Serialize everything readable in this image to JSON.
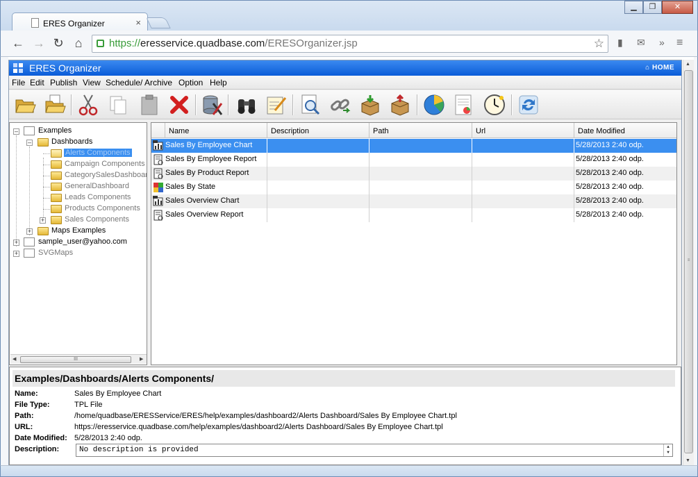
{
  "browser": {
    "tab_title": "ERES Organizer",
    "tab_close": "×",
    "url_scheme": "https://",
    "url_host": "eresservice.quadbase.com",
    "url_path": "/ERESOrganizer.jsp",
    "window_buttons": [
      "▁",
      "❐",
      "✕"
    ]
  },
  "app": {
    "title": "ERES Organizer",
    "home_label": "HOME"
  },
  "menu": [
    "File",
    "Edit",
    "Publish",
    "View",
    "Schedule/ Archive",
    "Option",
    "Help"
  ],
  "toolbar": [
    "open-folder-icon",
    "new-folder-icon",
    "cut-icon",
    "copy-icon",
    "paste-icon",
    "delete-icon",
    "database-tools-icon",
    "find-icon",
    "edit-notes-icon",
    "preview-icon",
    "link-icon",
    "import-package-icon",
    "export-package-icon",
    "pie-chart-icon",
    "report-icon",
    "scheduler-clock-icon",
    "refresh-icon"
  ],
  "tree": {
    "nodes": [
      {
        "label": "Examples",
        "level": 0,
        "type": "doc",
        "expanded": true
      },
      {
        "label": "Dashboards",
        "level": 1,
        "type": "folder",
        "expanded": true
      },
      {
        "label": "Alerts Components",
        "level": 2,
        "type": "folder",
        "selected": true
      },
      {
        "label": "Campaign Components",
        "level": 2,
        "type": "folder"
      },
      {
        "label": "CategorySalesDashboard",
        "level": 2,
        "type": "folder"
      },
      {
        "label": "GeneralDashboard",
        "level": 2,
        "type": "folder"
      },
      {
        "label": "Leads Components",
        "level": 2,
        "type": "folder"
      },
      {
        "label": "Products Components",
        "level": 2,
        "type": "folder"
      },
      {
        "label": "Sales Components",
        "level": 2,
        "type": "folder",
        "collapsed": true
      },
      {
        "label": "Maps Examples",
        "level": 1,
        "type": "folder",
        "collapsed": true
      },
      {
        "label": "sample_user@yahoo.com",
        "level": 0,
        "type": "doc",
        "collapsed": true
      },
      {
        "label": "SVGMaps",
        "level": 0,
        "type": "doc",
        "collapsed": true,
        "gray": true
      }
    ],
    "scroll_grip": "III"
  },
  "table": {
    "columns": [
      "Name",
      "Description",
      "Path",
      "Url",
      "Date Modified"
    ],
    "rows": [
      {
        "name": "Sales By Employee Chart",
        "description": "",
        "path": "",
        "url": "",
        "modified": "5/28/2013 2:40 odp.",
        "icon": "chart-template-icon",
        "selected": true
      },
      {
        "name": "Sales By Employee Report",
        "description": "",
        "path": "",
        "url": "",
        "modified": "5/28/2013 2:40 odp.",
        "icon": "report-template-icon"
      },
      {
        "name": "Sales By Product Report",
        "description": "",
        "path": "",
        "url": "",
        "modified": "5/28/2013 2:40 odp.",
        "icon": "report-template-icon"
      },
      {
        "name": "Sales By State",
        "description": "",
        "path": "",
        "url": "",
        "modified": "5/28/2013 2:40 odp.",
        "icon": "map-template-icon"
      },
      {
        "name": "Sales Overview Chart",
        "description": "",
        "path": "",
        "url": "",
        "modified": "5/28/2013 2:40 odp.",
        "icon": "chart-template-icon"
      },
      {
        "name": "Sales Overview Report",
        "description": "",
        "path": "",
        "url": "",
        "modified": "5/28/2013 2:40 odp.",
        "icon": "report-template-icon"
      }
    ]
  },
  "details": {
    "breadcrumb": "Examples/Dashboards/Alerts Components/",
    "fields": [
      {
        "label": "Name:",
        "value": "Sales By Employee Chart"
      },
      {
        "label": "File Type:",
        "value": "TPL File"
      },
      {
        "label": "Path:",
        "value": "/home/quadbase/ERESService/ERES/help/examples/dashboard2/Alerts Dashboard/Sales By Employee Chart.tpl"
      },
      {
        "label": "URL:",
        "value": "https://eresservice.quadbase.com/help/examples/dashboard2/Alerts Dashboard/Sales By Employee Chart.tpl"
      },
      {
        "label": "Date Modified:",
        "value": "5/28/2013 2:40 odp."
      }
    ],
    "description_label": "Description:",
    "description_value": "No description is provided"
  },
  "colors": {
    "header_blue": "#0a5cd8",
    "selection_blue": "#3b8ff0",
    "secure_green": "#3a9c3a"
  }
}
